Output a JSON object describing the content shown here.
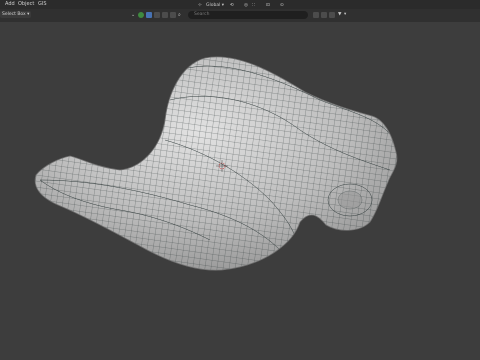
{
  "menu": [
    {
      "label": "Add"
    },
    {
      "label": "Object"
    },
    {
      "label": "GIS"
    }
  ],
  "toolbar": {
    "select_box_label": "Select Box",
    "transform_orientation": "Global",
    "search_placeholder": "Search"
  },
  "colors": {
    "background": "#3d3d3d",
    "mesh": "#c9c9c9",
    "wire": "#2f3a3a",
    "gizmo_x": "#e0344f",
    "gizmo_y": "#5ea62f",
    "gizmo_z": "#3a7ee6"
  },
  "icons": [
    "cursor-icon",
    "sphere-icon",
    "camera-icon",
    "link-icon",
    "magnet-icon",
    "snap-icon",
    "filter-icon",
    "proportional-edit-icon",
    "viewport-shading-icon"
  ]
}
